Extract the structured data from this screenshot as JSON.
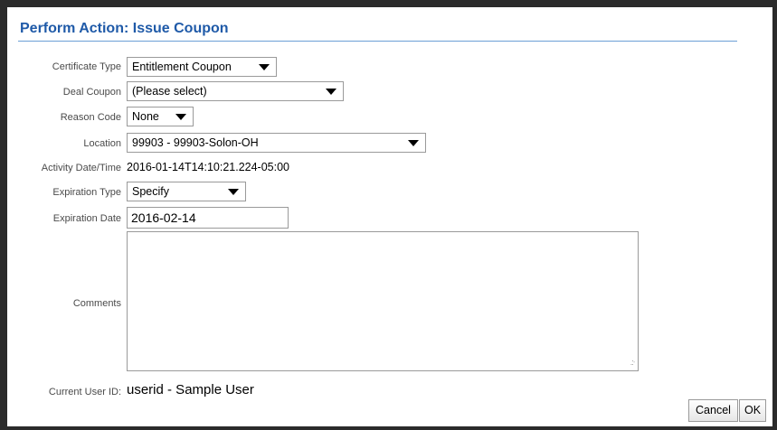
{
  "dialog": {
    "title": "Perform Action: Issue Coupon"
  },
  "form": {
    "certificate_type": {
      "label": "Certificate Type",
      "value": "Entitlement Coupon"
    },
    "deal_coupon": {
      "label": "Deal Coupon",
      "value": "(Please select)"
    },
    "reason_code": {
      "label": "Reason Code",
      "value": "None"
    },
    "location": {
      "label": "Location",
      "value": "99903 - 99903-Solon-OH"
    },
    "activity_datetime": {
      "label": "Activity Date/Time",
      "value": "2016-01-14T14:10:21.224-05:00"
    },
    "expiration_type": {
      "label": "Expiration Type",
      "value": "Specify"
    },
    "expiration_date": {
      "label": "Expiration Date",
      "value": "2016-02-14"
    },
    "comments": {
      "label": "Comments",
      "value": ""
    },
    "current_user": {
      "label": "Current User ID:",
      "value": "userid - Sample User"
    }
  },
  "buttons": {
    "cancel": "Cancel",
    "ok": "OK"
  },
  "icons": {
    "dropdown": "caret-down-icon",
    "resize": "resize-grip-icon"
  },
  "colors": {
    "title": "#1f5aa8",
    "title_rule": "#6b9fd6",
    "frame": "#2b2b2b"
  }
}
